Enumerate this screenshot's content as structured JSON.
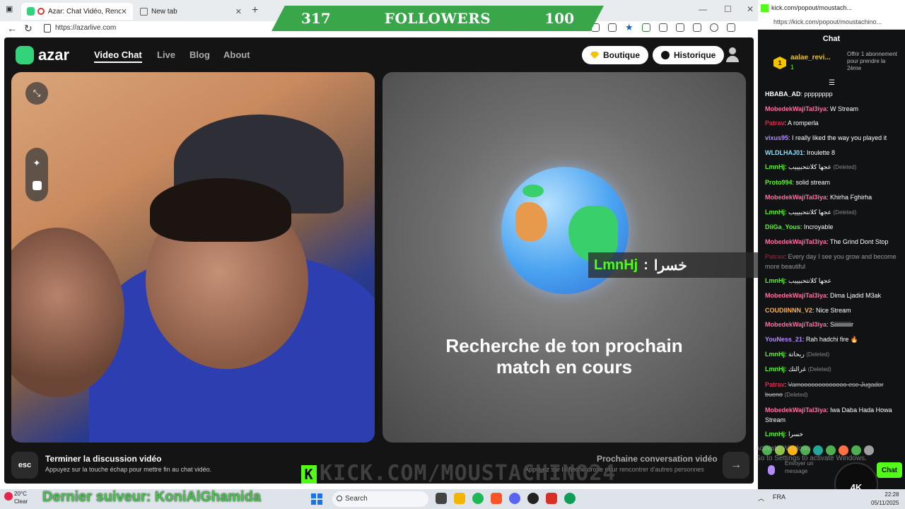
{
  "left_browser": {
    "tabs": [
      {
        "label": "Azar: Chat Vidéo, Rencontre",
        "close": "✕"
      },
      {
        "label": "New tab",
        "close": "✕"
      }
    ],
    "new_tab": "+",
    "url": "https://azarlive.com",
    "window_controls": {
      "minimize": "—",
      "maximize": "☐",
      "close": "✕"
    }
  },
  "followers_banner": {
    "left": "317",
    "label": "FOLLOWERS",
    "right": "100"
  },
  "azar": {
    "brand": "azar",
    "nav": [
      "Video Chat",
      "Live",
      "Blog",
      "About"
    ],
    "boutique": "Boutique",
    "historique": "Historique",
    "searching_line1": "Recherche de ton prochain",
    "searching_line2": "match en cours",
    "bottom": {
      "esc": "esc",
      "end_title": "Terminer la discussion vidéo",
      "end_desc": "Appuyez sur la touche échap pour mettre fin au chat vidéo.",
      "next_title": "Prochaine conversation vidéo",
      "next_desc": "Appuyez sur la flèche droite pour rencontrer d'autres personnes",
      "next_arrow": "→"
    }
  },
  "overlay_chat": {
    "user": "LmnHj",
    "sep": ":",
    "message": "خسرا"
  },
  "kick_watermark": {
    "k": "K",
    "text": "KICK.COM/MOUSTACHINO24"
  },
  "right_browser": {
    "title": "kick.com/popout/moustach...",
    "url": "https://kick.com/popout/moustachino...",
    "chat_header": "Chat",
    "pinned": {
      "badge": "1",
      "user": "aalae_revi...",
      "count": "1",
      "offer": "Offrir 1 abonnement pour prendre la 2ème"
    },
    "messages": [
      {
        "user": "HBABA_AD",
        "color": "white",
        "text": "pppppppp"
      },
      {
        "user": "MobedekWajiTal3iya",
        "color": "pink",
        "text": "W Stream"
      },
      {
        "user": "Patrav",
        "color": "red",
        "text": "A romperla"
      },
      {
        "user": "vixus95",
        "color": "purple",
        "text": "I really liked the way you played it"
      },
      {
        "user": "WLDLHAJ01",
        "color": "cyan",
        "text": "Iroulette 8"
      },
      {
        "user": "LmnHj",
        "color": "green",
        "text": "عجها كلانتحبيييب",
        "deleted": "(Deleted)"
      },
      {
        "user": "Proto994",
        "color": "green",
        "text": "solid stream"
      },
      {
        "user": "MobedekWajiTal3iya",
        "color": "pink",
        "text": "Khirha Fghirha"
      },
      {
        "user": "LmnHj",
        "color": "green",
        "text": "عجها كلانتحبيييب",
        "deleted": "(Deleted)"
      },
      {
        "user": "DiiGa_Yous",
        "color": "green",
        "text": "Incroyable"
      },
      {
        "user": "MobedekWajiTal3iya",
        "color": "pink",
        "text": "The Grind Dont Stop"
      },
      {
        "user": "Patrav",
        "color": "red",
        "text": "Every day I see you grow and become more beautiful",
        "faded": true
      },
      {
        "user": "LmnHj",
        "color": "green",
        "text": "عجها كلانتحبيييب"
      },
      {
        "user": "MobedekWajiTal3iya",
        "color": "pink",
        "text": "Dima Ljadid M3ak"
      },
      {
        "user": "COUDIINNN_V2",
        "color": "orange",
        "text": "Nice Stream"
      },
      {
        "user": "MobedekWajiTal3iya",
        "color": "pink",
        "text": "Siiiiiiiiiiiir"
      },
      {
        "user": "YouNess_21",
        "color": "purple",
        "text": "Rah hadchi fire 🔥"
      },
      {
        "user": "LmnHj",
        "color": "green",
        "text": "ربحاتة",
        "deleted": "(Deleted)"
      },
      {
        "user": "LmnHj",
        "color": "green",
        "text": "غرالتك",
        "deleted": "(Deleted)"
      },
      {
        "user": "Patrav",
        "color": "red",
        "text": "Vamooooooooooooo ese Jugador bueno",
        "deleted": "(Deleted)",
        "strike": true
      },
      {
        "user": "MobedekWajiTal3iya",
        "color": "pink",
        "text": "Iwa Daba Hada Howa Stream"
      },
      {
        "user": "LmnHj",
        "color": "green",
        "text": "خسرا"
      }
    ],
    "send_placeholder": "Envoyer un message",
    "chat_button": "Chat"
  },
  "activate_windows": {
    "line1": "Activate Windows",
    "line2": "Go to Settings to activate Windows."
  },
  "logo_4k": "4K",
  "taskbar": {
    "weather_temp": "20°C",
    "weather_desc": "Clear",
    "last_follower": "Dernier suiveur: KoniAlGhamida",
    "search": "Search",
    "lang": "FRA",
    "time": "22:28",
    "date": "05/11/2025"
  }
}
